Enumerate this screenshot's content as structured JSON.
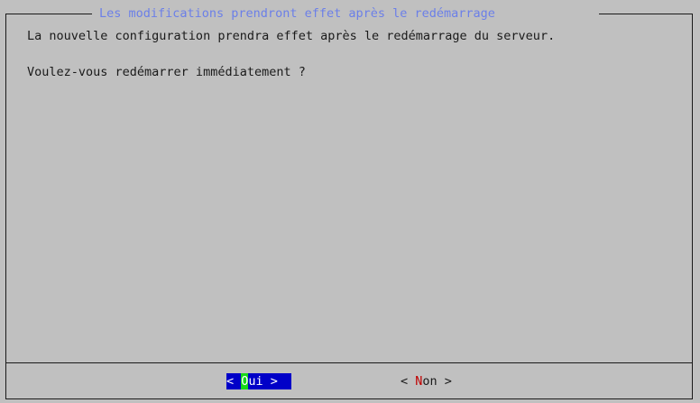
{
  "dialog": {
    "title": "Les modifications prendront effet après le redémarrage",
    "message_line1": "La nouvelle configuration prendra effet après le redémarrage du serveur.",
    "message_line2": "Voulez-vous redémarrer immédiatement ?"
  },
  "buttons": {
    "oui": {
      "open": "< ",
      "hotkey": "O",
      "rest": "ui",
      "close": " >"
    },
    "non": {
      "open": "< ",
      "hotkey": "N",
      "rest": "on",
      "close": " >"
    }
  },
  "colors": {
    "background": "#c0c0c0",
    "title": "#6b7fe8",
    "selected_button_bg": "#0000c8",
    "hotkey_highlight": "#18d818",
    "hotkey_text": "#c00000"
  }
}
